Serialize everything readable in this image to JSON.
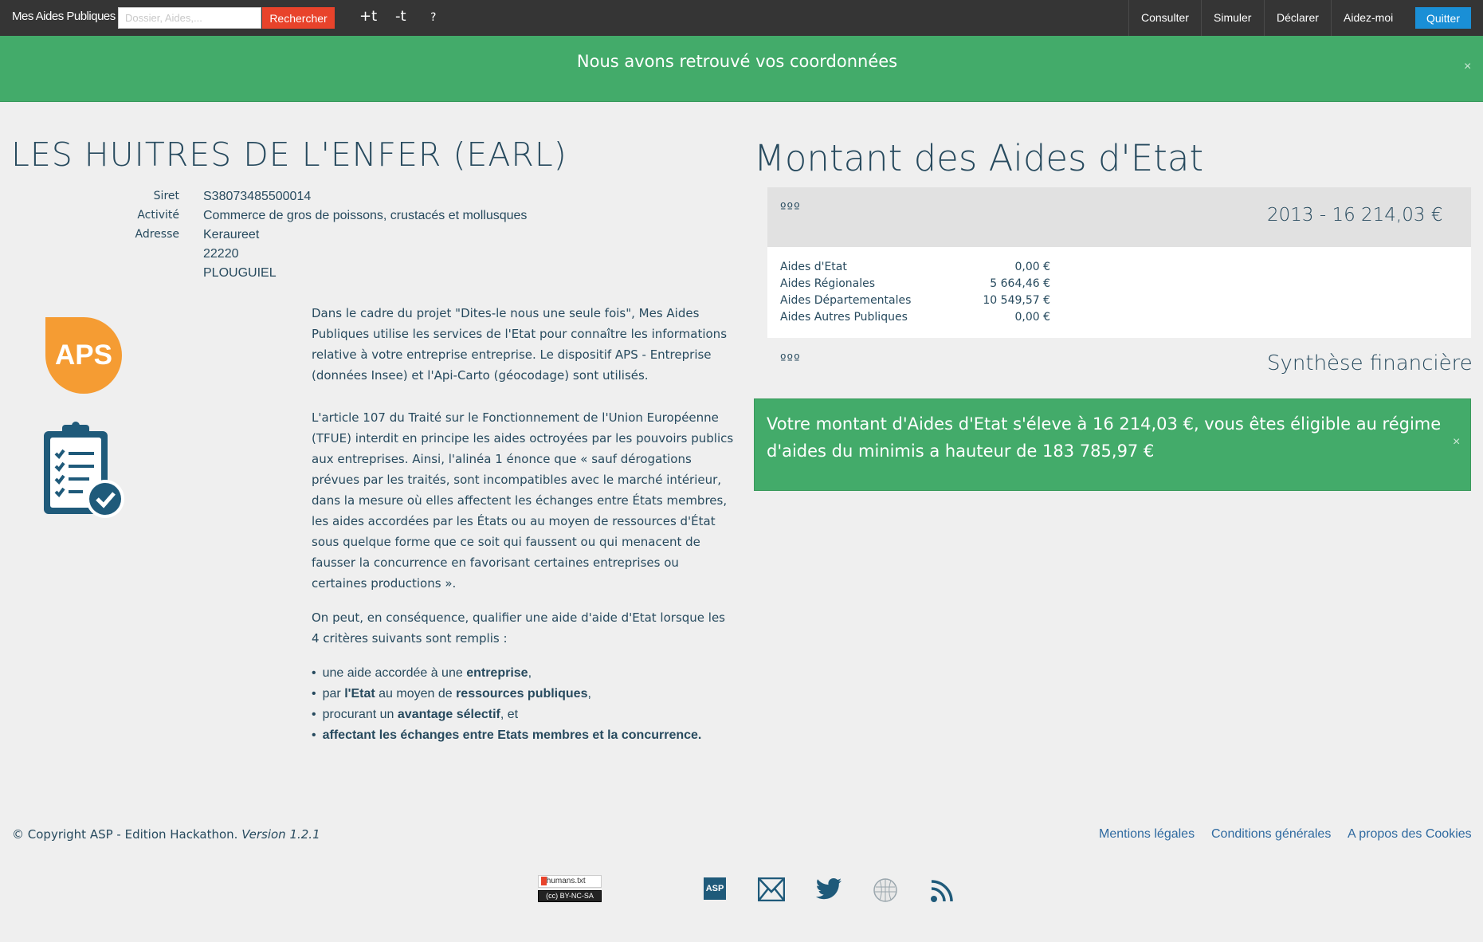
{
  "navbar": {
    "brand": "Mes Aides Publiques",
    "search_placeholder": "Dossier, Aides,...",
    "search_button": "Rechercher",
    "increase_font": "+t",
    "decrease_font": "-t",
    "help": "?",
    "links": [
      "Consulter",
      "Simuler",
      "Déclarer",
      "Aidez-moi"
    ],
    "quit": "Quitter"
  },
  "alert_top": {
    "message": "Nous avons retrouvé vos coordonnées",
    "close": "×"
  },
  "company": {
    "name": "LES HUITRES DE L'ENFER (EARL)",
    "siret_label": "Siret",
    "siret": "S38073485500014",
    "activity_label": "Activité",
    "activity": "Commerce de gros de poissons, crustacés et mollusques",
    "address_label": "Adresse",
    "address_line1": "Keraureet",
    "postal_code": "22220",
    "city": "PLOUGUIEL"
  },
  "aps_badge": "APS",
  "paragraphs": {
    "p1": "Dans le cadre du projet \"Dites-le nous une seule fois\", Mes Aides Publiques utilise les services de l'Etat pour connaître les informations relative à votre entreprise entreprise. Le dispositif APS - Entreprise (données Insee) et l'Api-Carto (géocodage) sont utilisés.",
    "p2": "L'article 107 du Traité sur le Fonctionnement de l'Union Européenne (TFUE) interdit en principe les aides octroyées par les pouvoirs publics aux entreprises. Ainsi, l'alinéa 1 énonce que « sauf dérogations prévues par les traités, sont incompatibles avec le marché intérieur, dans la mesure où elles affectent les échanges entre États membres, les aides accordées par les États ou au moyen de ressources d'État sous quelque forme que ce soit qui faussent ou qui menacent de fausser la concurrence en favorisant certaines entreprises ou certaines productions ».",
    "p3": "On peut, en conséquence, qualifier une aide d'aide d'Etat lorsque les 4 critères suivants sont remplis :"
  },
  "criteria": [
    {
      "pre": "une aide accordée à une ",
      "bold": "entreprise",
      "post": ","
    },
    {
      "pre": "par ",
      "bold": "l'Etat",
      "mid": " au moyen de ",
      "bold2": "ressources publiques",
      "post": ","
    },
    {
      "pre": "procurant un ",
      "bold": "avantage sélectif",
      "post": ", et"
    },
    {
      "pre": "",
      "bold": "affectant les échanges entre Etats membres et la concurrence.",
      "post": ""
    }
  ],
  "state_aid": {
    "title": "Montant des Aides d'Etat",
    "dots": "ººº",
    "year_total": "2013  -  16 214,03 €",
    "rows": [
      {
        "label": "Aides d'Etat",
        "value": "0,00 €"
      },
      {
        "label": "Aides Régionales",
        "value": "5 664,46 €"
      },
      {
        "label": "Aides Départementales",
        "value": "10 549,57 €"
      },
      {
        "label": "Aides Autres Publiques",
        "value": "0,00 €"
      }
    ],
    "synthesis": "Synthèse financière"
  },
  "alert_eligible": {
    "message": "Votre montant d'Aides d'Etat s'éleve à 16 214,03 €, vous êtes éligible au régime d'aides du minimis a hauteur de 183 785,97 €",
    "close": "×"
  },
  "footer": {
    "copyright": "© Copyright ASP - Edition Hackathon.",
    "version": "Version 1.2.1",
    "links": [
      "Mentions légales",
      "Conditions générales",
      "A propos des Cookies"
    ],
    "humans": "humans.txt",
    "license": "BY-NC-SA",
    "asp": "ASP"
  },
  "colors": {
    "navbar": "#353535",
    "success": "#43ab6a",
    "search_button": "#e8432b",
    "quit_button": "#1a8fd6",
    "aps": "#f59c33",
    "text": "#274a5e"
  }
}
